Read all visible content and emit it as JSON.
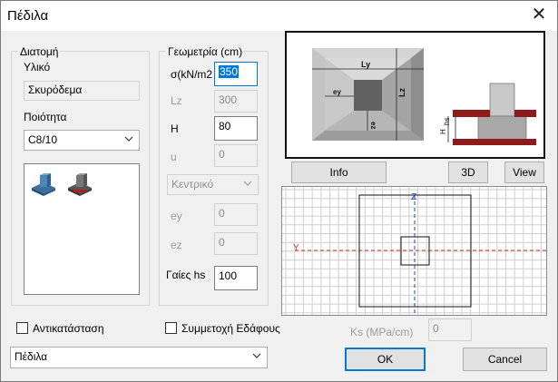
{
  "window": {
    "title": "Πέδιλα",
    "close_glyph": "✕"
  },
  "section": {
    "group_label": "Διατομή",
    "material_label": "Υλικό",
    "material_value": "Σκυρόδεμα",
    "quality_label": "Ποιότητα",
    "quality_value": "C8/10"
  },
  "geometry": {
    "group_label": "Γεωμετρία (cm)",
    "sigma_label": "σ(kN/m2",
    "sigma_value": "350",
    "lz_label": "Lz",
    "lz_value": "300",
    "h_label": "H",
    "h_value": "80",
    "u_label": "u",
    "u_value": "0",
    "position_value": "Κεντρικό",
    "ey_label": "ey",
    "ey_value": "0",
    "ez_label": "ez",
    "ez_value": "0",
    "hs_label": "Γαίες hs",
    "hs_value": "100"
  },
  "preview": {
    "ly_label": "Ly",
    "lz_label": "Lz",
    "ey_label": "ey",
    "ez_label": "ez",
    "h_label": "H",
    "hs_label": "hs"
  },
  "buttons": {
    "info": "Info",
    "three_d": "3D",
    "view": "View",
    "ok": "OK",
    "cancel": "Cancel"
  },
  "grid": {
    "z_label": "Z",
    "y_label": "Y"
  },
  "options": {
    "replace_label": "Αντικατάσταση",
    "replace_checked": false,
    "soil_label": "Συμμετοχή Εδάφους",
    "soil_checked": false,
    "ks_label": "Ks (MPa/cm)",
    "ks_value": "0",
    "type_value": "Πέδιλα"
  },
  "colors": {
    "accent": "#0078d7",
    "axis_red": "#d9302a",
    "axis_blue": "#1f3fb0",
    "soil_red": "#8e1a1a"
  },
  "icons": [
    "footing-blue-icon",
    "footing-dark-icon",
    "chevron-down-icon",
    "close-icon"
  ]
}
